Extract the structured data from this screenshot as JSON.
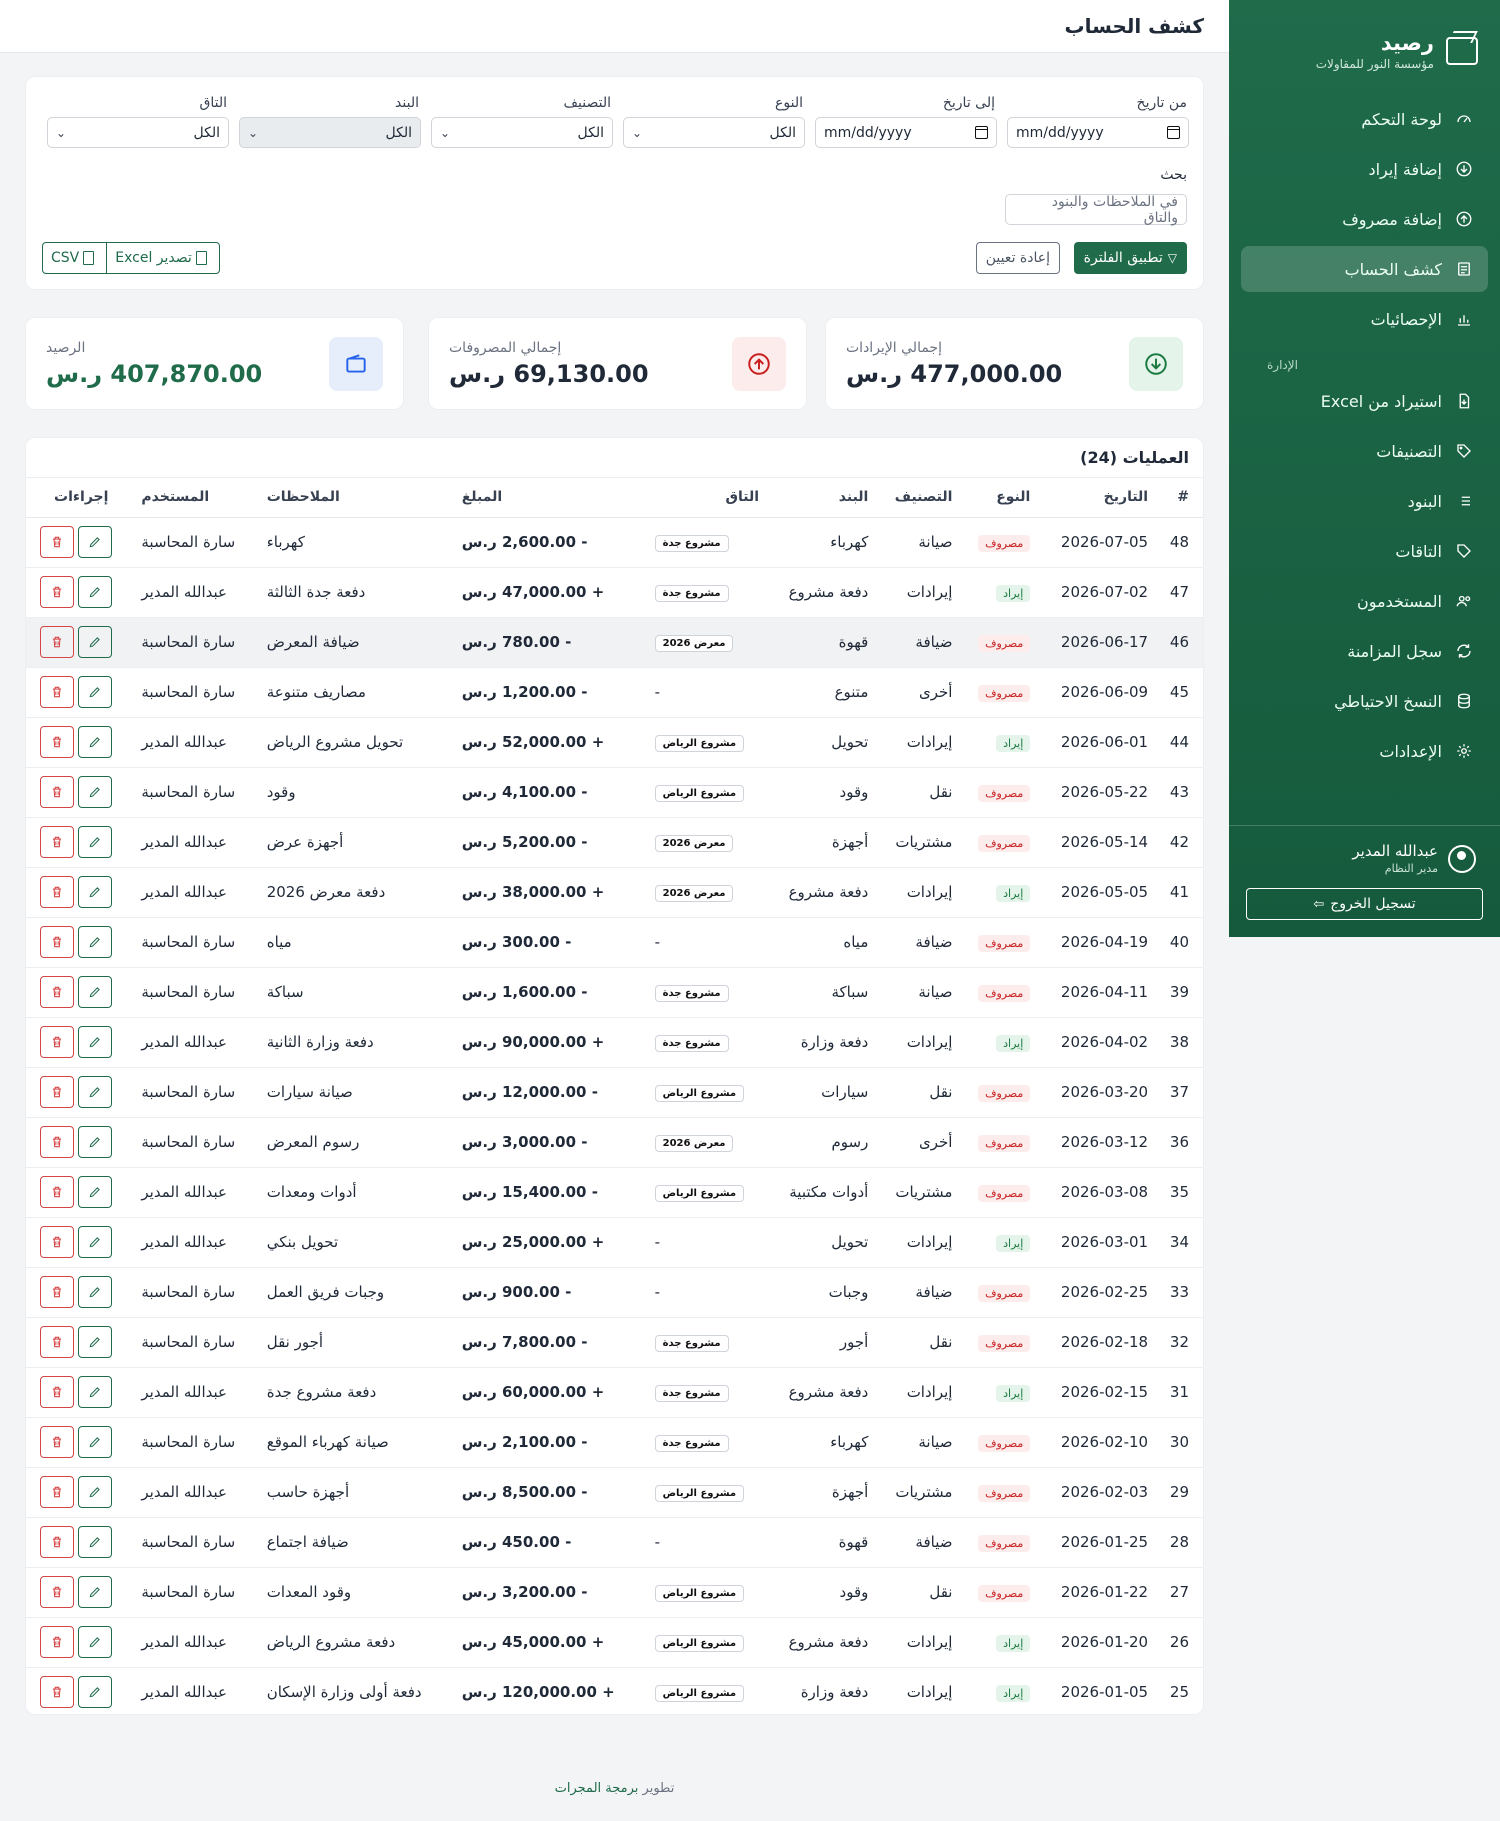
{
  "brand": {
    "name": "رصيد",
    "subtitle": "مؤسسة النور للمقاولات"
  },
  "nav": {
    "items": [
      {
        "label": "لوحة التحكم",
        "icon": "gauge-icon"
      },
      {
        "label": "إضافة إيراد",
        "icon": "arrow-down-circle-icon"
      },
      {
        "label": "إضافة مصروف",
        "icon": "arrow-up-circle-icon"
      },
      {
        "label": "كشف الحساب",
        "icon": "list-icon",
        "active": true
      },
      {
        "label": "الإحصائيات",
        "icon": "bar-chart-icon"
      }
    ],
    "section": "الإدارة",
    "admin_items": [
      {
        "label": "استيراد من Excel",
        "icon": "file-import-icon"
      },
      {
        "label": "التصنيفات",
        "icon": "tag-icon"
      },
      {
        "label": "البنود",
        "icon": "list-bullets-icon"
      },
      {
        "label": "التاقات",
        "icon": "tags-icon"
      },
      {
        "label": "المستخدمون",
        "icon": "users-icon"
      },
      {
        "label": "سجل المزامنة",
        "icon": "sync-icon"
      },
      {
        "label": "النسخ الاحتياطي",
        "icon": "database-icon"
      },
      {
        "label": "الإعدادات",
        "icon": "gear-icon"
      }
    ]
  },
  "user": {
    "name": "عبدالله المدير",
    "role": "مدير النظام",
    "logout": "تسجيل الخروج"
  },
  "header": {
    "title": "كشف الحساب"
  },
  "filters": {
    "from_label": "من تاريخ",
    "from_value": "mm/dd/yyyy",
    "to_label": "إلى تاريخ",
    "to_value": "mm/dd/yyyy",
    "type_label": "النوع",
    "type_value": "الكل",
    "category_label": "التصنيف",
    "category_value": "الكل",
    "item_label": "البند",
    "item_value": "الكل",
    "tag_label": "التاق",
    "tag_value": "الكل",
    "search_label": "بحث",
    "search_placeholder": "في الملاحظات والبنود والتاق",
    "apply": "تطبيق الفلترة",
    "reset": "إعادة تعيين",
    "export_excel": "تصدير Excel",
    "export_csv": "CSV"
  },
  "stats": {
    "income_label": "إجمالي الإيرادات",
    "income_value": "477,000.00 ر.س",
    "expense_label": "إجمالي المصروفات",
    "expense_value": "69,130.00 ر.س",
    "balance_label": "الرصيد",
    "balance_value": "407,870.00 ر.س",
    "income_color": "#1a7a3f",
    "expense_color": "#c81e1e",
    "balance_color": "#1f6b4a"
  },
  "table": {
    "title": "العمليات (24)",
    "columns": [
      "#",
      "التاريخ",
      "النوع",
      "التصنيف",
      "البند",
      "التاق",
      "المبلغ",
      "الملاحظات",
      "المستخدم",
      "إجراءات"
    ],
    "rows": [
      [
        "48",
        "2026-07-05",
        "مصروف",
        "صيانة",
        "كهرباء",
        "مشروع جدة",
        "- 2,600.00 ر.س",
        "كهرباء",
        "سارة المحاسبة"
      ],
      [
        "47",
        "2026-07-02",
        "إيراد",
        "إيرادات",
        "دفعة مشروع",
        "مشروع جدة",
        "+ 47,000.00 ر.س",
        "دفعة جدة الثالثة",
        "عبدالله المدير"
      ],
      [
        "46",
        "2026-06-17",
        "مصروف",
        "ضيافة",
        "قهوة",
        "معرض 2026",
        "- 780.00 ر.س",
        "ضيافة المعرض",
        "سارة المحاسبة"
      ],
      [
        "45",
        "2026-06-09",
        "مصروف",
        "أخرى",
        "متنوع",
        "-",
        "- 1,200.00 ر.س",
        "مصاريف متنوعة",
        "سارة المحاسبة"
      ],
      [
        "44",
        "2026-06-01",
        "إيراد",
        "إيرادات",
        "تحويل",
        "مشروع الرياض",
        "+ 52,000.00 ر.س",
        "تحويل مشروع الرياض",
        "عبدالله المدير"
      ],
      [
        "43",
        "2026-05-22",
        "مصروف",
        "نقل",
        "وقود",
        "مشروع الرياض",
        "- 4,100.00 ر.س",
        "وقود",
        "سارة المحاسبة"
      ],
      [
        "42",
        "2026-05-14",
        "مصروف",
        "مشتريات",
        "أجهزة",
        "معرض 2026",
        "- 5,200.00 ر.س",
        "أجهزة عرض",
        "عبدالله المدير"
      ],
      [
        "41",
        "2026-05-05",
        "إيراد",
        "إيرادات",
        "دفعة مشروع",
        "معرض 2026",
        "+ 38,000.00 ر.س",
        "دفعة معرض 2026",
        "عبدالله المدير"
      ],
      [
        "40",
        "2026-04-19",
        "مصروف",
        "ضيافة",
        "مياه",
        "-",
        "- 300.00 ر.س",
        "مياه",
        "سارة المحاسبة"
      ],
      [
        "39",
        "2026-04-11",
        "مصروف",
        "صيانة",
        "سباكة",
        "مشروع جدة",
        "- 1,600.00 ر.س",
        "سباكة",
        "سارة المحاسبة"
      ],
      [
        "38",
        "2026-04-02",
        "إيراد",
        "إيرادات",
        "دفعة وزارة",
        "مشروع جدة",
        "+ 90,000.00 ر.س",
        "دفعة وزارة الثانية",
        "عبدالله المدير"
      ],
      [
        "37",
        "2026-03-20",
        "مصروف",
        "نقل",
        "سيارات",
        "مشروع الرياض",
        "- 12,000.00 ر.س",
        "صيانة سيارات",
        "سارة المحاسبة"
      ],
      [
        "36",
        "2026-03-12",
        "مصروف",
        "أخرى",
        "رسوم",
        "معرض 2026",
        "- 3,000.00 ر.س",
        "رسوم المعرض",
        "سارة المحاسبة"
      ],
      [
        "35",
        "2026-03-08",
        "مصروف",
        "مشتريات",
        "أدوات مكتبية",
        "مشروع الرياض",
        "- 15,400.00 ر.س",
        "أدوات ومعدات",
        "عبدالله المدير"
      ],
      [
        "34",
        "2026-03-01",
        "إيراد",
        "إيرادات",
        "تحويل",
        "-",
        "+ 25,000.00 ر.س",
        "تحويل بنكي",
        "عبدالله المدير"
      ],
      [
        "33",
        "2026-02-25",
        "مصروف",
        "ضيافة",
        "وجبات",
        "-",
        "- 900.00 ر.س",
        "وجبات فريق العمل",
        "سارة المحاسبة"
      ],
      [
        "32",
        "2026-02-18",
        "مصروف",
        "نقل",
        "أجور",
        "مشروع جدة",
        "- 7,800.00 ر.س",
        "أجور نقل",
        "سارة المحاسبة"
      ],
      [
        "31",
        "2026-02-15",
        "إيراد",
        "إيرادات",
        "دفعة مشروع",
        "مشروع جدة",
        "+ 60,000.00 ر.س",
        "دفعة مشروع جدة",
        "عبدالله المدير"
      ],
      [
        "30",
        "2026-02-10",
        "مصروف",
        "صيانة",
        "كهرباء",
        "مشروع جدة",
        "- 2,100.00 ر.س",
        "صيانة كهرباء الموقع",
        "سارة المحاسبة"
      ],
      [
        "29",
        "2026-02-03",
        "مصروف",
        "مشتريات",
        "أجهزة",
        "مشروع الرياض",
        "- 8,500.00 ر.س",
        "أجهزة حاسب",
        "عبدالله المدير"
      ],
      [
        "28",
        "2026-01-25",
        "مصروف",
        "ضيافة",
        "قهوة",
        "-",
        "- 450.00 ر.س",
        "ضيافة اجتماع",
        "سارة المحاسبة"
      ],
      [
        "27",
        "2026-01-22",
        "مصروف",
        "نقل",
        "وقود",
        "مشروع الرياض",
        "- 3,200.00 ر.س",
        "وقود المعدات",
        "سارة المحاسبة"
      ],
      [
        "26",
        "2026-01-20",
        "إيراد",
        "إيرادات",
        "دفعة مشروع",
        "مشروع الرياض",
        "+ 45,000.00 ر.س",
        "دفعة مشروع الرياض",
        "عبدالله المدير"
      ],
      [
        "25",
        "2026-01-05",
        "إيراد",
        "إيرادات",
        "دفعة وزارة",
        "مشروع الرياض",
        "+ 120,000.00 ر.س",
        "دفعة أولى وزارة الإسكان",
        "عبدالله المدير"
      ]
    ]
  },
  "footer": {
    "prefix": "تطوير",
    "author": "برمجة المجرات"
  }
}
